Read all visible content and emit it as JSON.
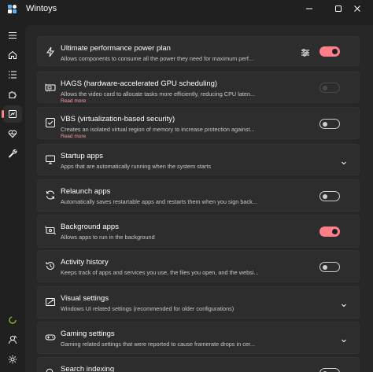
{
  "app": {
    "title": "Wintoys"
  },
  "colors": {
    "accent": "#ff7f89",
    "background": "#202020",
    "card": "#2d2d2d"
  },
  "cards": [
    {
      "title": "Ultimate performance power plan",
      "desc": "Allows components to consume all the power they need for maximum perf...",
      "icon": "lightning-icon",
      "control": "toggle-on",
      "extra": "tune-icon"
    },
    {
      "title": "HAGS (hardware-accelerated GPU scheduling)",
      "desc": "Allows the video card to allocate tasks more efficiently, reducing CPU laten...",
      "link": "Read more",
      "icon": "gpu-icon",
      "control": "toggle-disabled"
    },
    {
      "title": "VBS (virtualization-based security)",
      "desc": "Creates an isolated virtual region of memory to increase protection against...",
      "link": "Read more",
      "icon": "shield-check-icon",
      "control": "toggle-off"
    },
    {
      "title": "Startup apps",
      "desc": "Apps that are automatically running when the system starts",
      "icon": "monitor-icon",
      "control": "chevron"
    },
    {
      "title": "Relaunch apps",
      "desc": "Automatically saves restartable apps and restarts them when you sign back...",
      "icon": "refresh-icon",
      "control": "toggle-off"
    },
    {
      "title": "Background apps",
      "desc": "Allows apps to run in the background",
      "icon": "background-apps-icon",
      "control": "toggle-on"
    },
    {
      "title": "Activity history",
      "desc": "Keeps track of apps and services you use, the files you open, and the websi...",
      "icon": "history-icon",
      "control": "toggle-off"
    },
    {
      "title": "Visual settings",
      "desc": "Windows UI related settings (recommended for older configurations)",
      "icon": "visual-icon",
      "control": "chevron"
    },
    {
      "title": "Gaming settings",
      "desc": "Gaming related settings that were reported to cause framerate drops in cer...",
      "icon": "gamepad-icon",
      "control": "chevron"
    },
    {
      "title": "Search indexing",
      "desc": "",
      "icon": "search-icon",
      "control": "toggle-off"
    }
  ]
}
